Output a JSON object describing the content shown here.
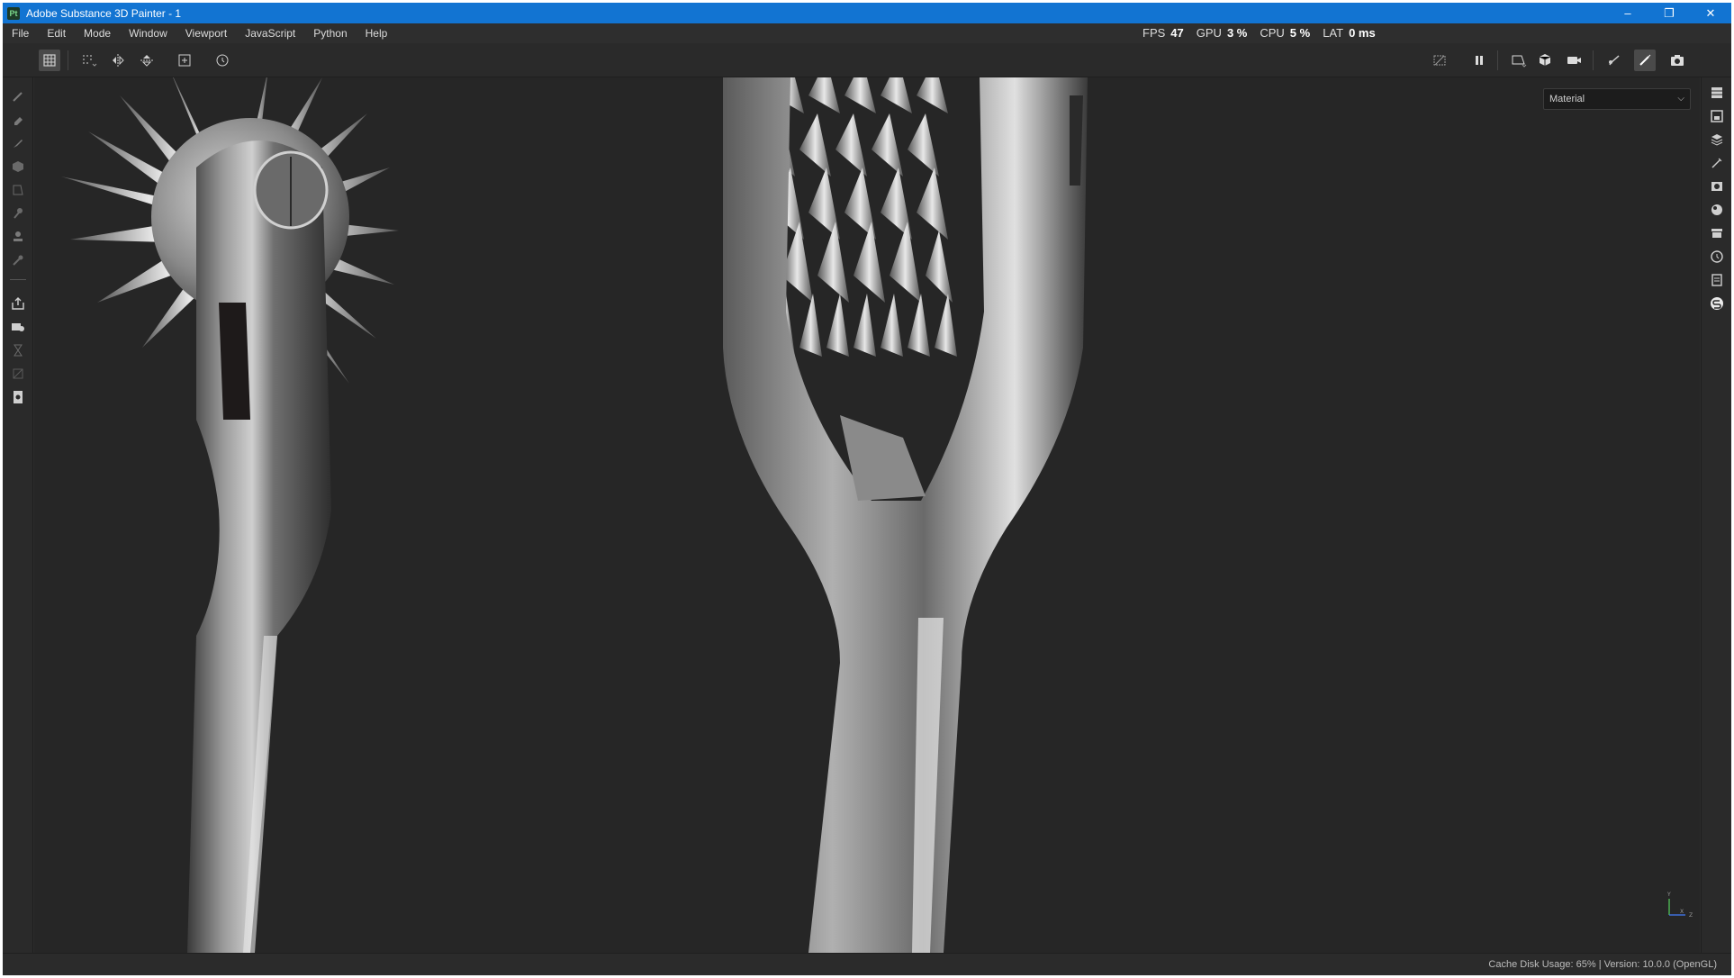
{
  "window": {
    "title": "Adobe Substance 3D Painter - 1",
    "logo_text": "Pt",
    "controls": {
      "minimize": "–",
      "restore": "❐",
      "close": "✕"
    }
  },
  "menu": [
    "File",
    "Edit",
    "Mode",
    "Window",
    "Viewport",
    "JavaScript",
    "Python",
    "Help"
  ],
  "performance": {
    "fps_label": "FPS",
    "fps_value": "47",
    "gpu_label": "GPU",
    "gpu_value": "3 %",
    "cpu_label": "CPU",
    "cpu_value": "5 %",
    "lat_label": "LAT",
    "lat_value": "0 ms"
  },
  "viewport": {
    "display_mode": "Material",
    "axis_labels": {
      "y": "Y",
      "x": "X",
      "z": "Z"
    }
  },
  "status": {
    "cache_label": "Cache Disk Usage:",
    "cache_value": "65%",
    "version": "Version: 10.0.0 (OpenGL)"
  },
  "colors": {
    "titlebar": "#1274d2",
    "background": "#262626",
    "panel": "#2a2a2a",
    "metal": "#8a8a8a"
  },
  "icons": {
    "left_tools": [
      "paint-brush-icon",
      "eraser-icon",
      "projection-icon",
      "geometry-fill-icon",
      "polygon-fill-icon",
      "smudge-icon",
      "clone-icon",
      "color-picker-icon",
      "export-icon",
      "bake-icon",
      "hourglass-icon",
      "mask-icon",
      "document-icon"
    ],
    "right_panels": [
      "layers-list-icon",
      "texture-set-icon",
      "layer-stack-icon",
      "properties-icon",
      "display-settings-icon",
      "shader-settings-icon",
      "assets-icon",
      "history-icon",
      "log-icon",
      "substance-icon"
    ]
  }
}
